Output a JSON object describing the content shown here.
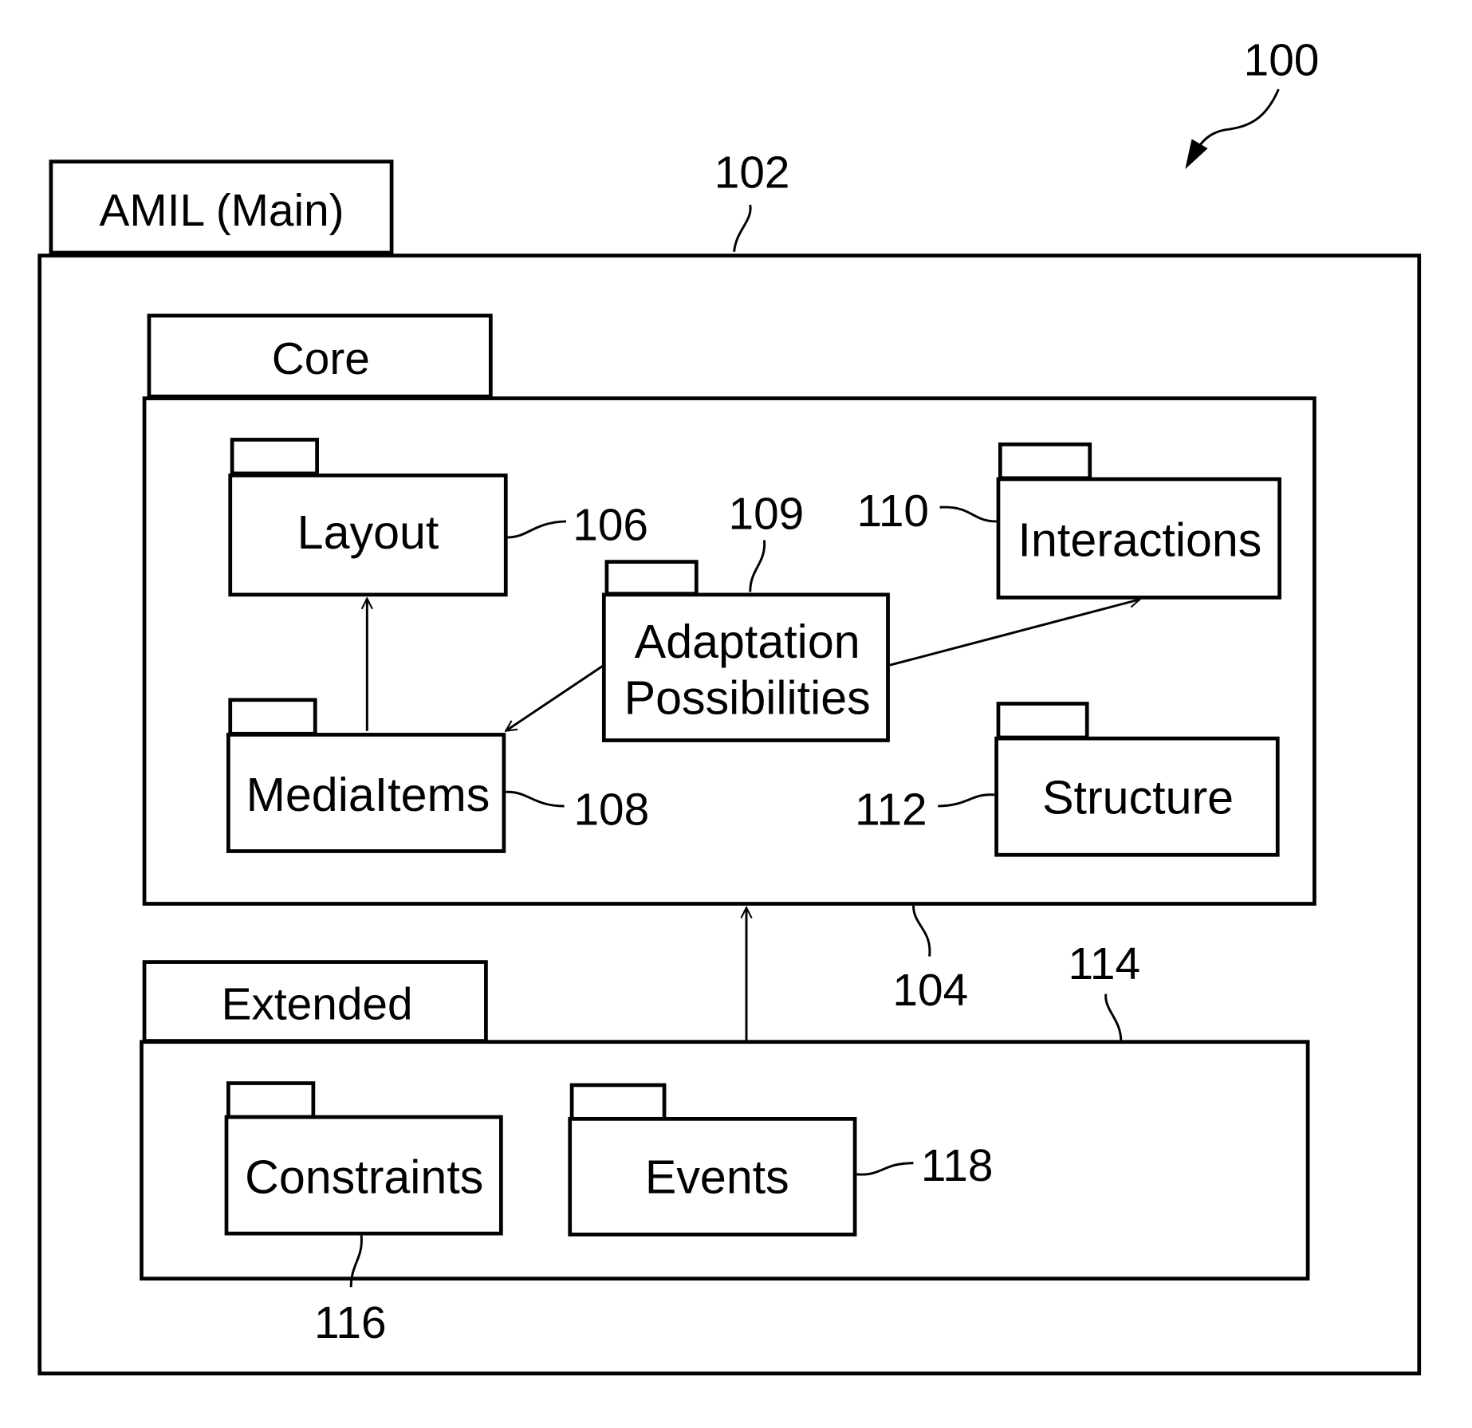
{
  "figure": {
    "ref": "100",
    "main_package": {
      "name": "AMIL (Main)",
      "ref": "102"
    },
    "core_package": {
      "name": "Core",
      "ref": "104"
    },
    "extended_package": {
      "name": "Extended",
      "ref": "114"
    },
    "core_modules": [
      {
        "name": "Layout",
        "ref": "106"
      },
      {
        "name": "MediaItems",
        "ref": "108"
      },
      {
        "name_line1": "Adaptation",
        "name_line2": "Possibilities",
        "ref": "109"
      },
      {
        "name": "Interactions",
        "ref": "110"
      },
      {
        "name": "Structure",
        "ref": "112"
      }
    ],
    "extended_modules": [
      {
        "name": "Constraints",
        "ref": "116"
      },
      {
        "name": "Events",
        "ref": "118"
      }
    ],
    "dependencies": [
      {
        "from": "MediaItems",
        "to": "Layout"
      },
      {
        "from": "Adaptation Possibilities",
        "to": "MediaItems"
      },
      {
        "from": "Adaptation Possibilities",
        "to": "Interactions"
      },
      {
        "from": "Extended",
        "to": "Core"
      }
    ]
  }
}
